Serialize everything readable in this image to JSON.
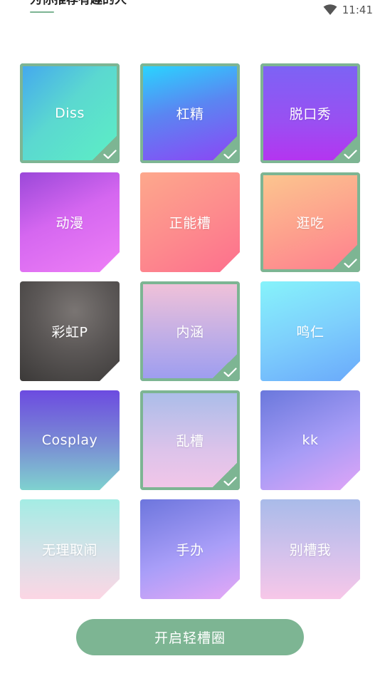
{
  "header": {
    "title": "为你推荐有趣的人"
  },
  "status_bar": {
    "time": "11:41",
    "wifi_icon": "wifi-icon"
  },
  "colors": {
    "accent": "#7db593"
  },
  "tiles": [
    {
      "label": "Diss",
      "selected": true
    },
    {
      "label": "杠精",
      "selected": true
    },
    {
      "label": "脱口秀",
      "selected": true
    },
    {
      "label": "动漫",
      "selected": false
    },
    {
      "label": "正能槽",
      "selected": false
    },
    {
      "label": "逛吃",
      "selected": true
    },
    {
      "label": "彩虹P",
      "selected": false
    },
    {
      "label": "内涵",
      "selected": true
    },
    {
      "label": "鸣仁",
      "selected": false
    },
    {
      "label": "Cosplay",
      "selected": false
    },
    {
      "label": "乱槽",
      "selected": true
    },
    {
      "label": "kk",
      "selected": false
    },
    {
      "label": "无理取闹",
      "selected": false
    },
    {
      "label": "手办",
      "selected": false
    },
    {
      "label": "别槽我",
      "selected": false
    }
  ],
  "footer": {
    "start_button": "开启轻槽圈"
  }
}
